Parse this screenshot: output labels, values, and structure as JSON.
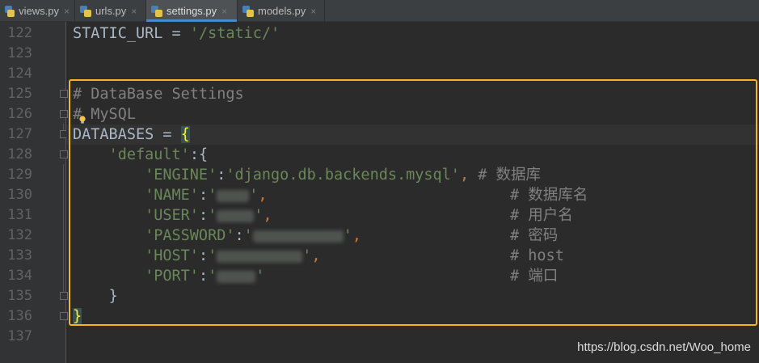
{
  "tabs": [
    {
      "label": "views.py",
      "active": false
    },
    {
      "label": "urls.py",
      "active": false
    },
    {
      "label": "settings.py",
      "active": true
    },
    {
      "label": "models.py",
      "active": false
    }
  ],
  "close_glyph": "×",
  "line_numbers": [
    "122",
    "123",
    "124",
    "125",
    "126",
    "127",
    "128",
    "129",
    "130",
    "131",
    "132",
    "133",
    "134",
    "135",
    "136",
    "137"
  ],
  "code": {
    "l122": {
      "name": "STATIC_URL",
      "op": " = ",
      "value": "'/static/'"
    },
    "l125": {
      "comment": "# DataBase Settings"
    },
    "l126": {
      "hash": "#",
      "text": " MySQL"
    },
    "l127": {
      "name": "DATABASES",
      "op": " = ",
      "brace": "{"
    },
    "l128": {
      "key": "'default'",
      "rest": ":{"
    },
    "l129": {
      "key": "'ENGINE'",
      "colon": ":",
      "value": "'django.db.backends.mysql'",
      "comma": ",",
      "comment": "# 数据库"
    },
    "l130": {
      "key": "'NAME'",
      "colon": ":",
      "open": "'",
      "close": "'",
      "comma": ",",
      "comment": "# 数据库名"
    },
    "l131": {
      "key": "'USER'",
      "colon": ":",
      "open": "'",
      "close": "'",
      "comma": ",",
      "comment": "# 用户名"
    },
    "l132": {
      "key": "'PASSWORD'",
      "colon": ":",
      "open": "'",
      "close": "'",
      "comma": ",",
      "comment": "# 密码"
    },
    "l133": {
      "key": "'HOST'",
      "colon": ":",
      "open": "'",
      "close": "'",
      "comma": ",",
      "comment": "# host"
    },
    "l134": {
      "key": "'PORT'",
      "colon": ":",
      "open": "'",
      "close": "'",
      "comment": "# 端口"
    },
    "l135": {
      "brace": "}"
    },
    "l136": {
      "brace": "}"
    }
  },
  "watermark": "https://blog.csdn.net/Woo_home",
  "colors": {
    "background": "#2b2b2b",
    "string": "#6a8759",
    "keyword": "#cc7832",
    "comment": "#808080",
    "highlight_box": "#f5b51e",
    "active_tab_underline": "#4a88c7"
  },
  "icons": [
    "python-file-icon",
    "close-icon",
    "lightbulb-icon",
    "fold-icon"
  ]
}
